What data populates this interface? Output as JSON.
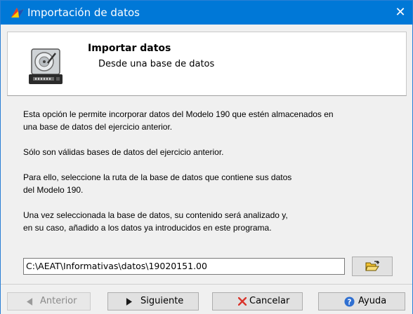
{
  "window": {
    "title": "Importación de datos",
    "close_glyph": "✕"
  },
  "header": {
    "title": "Importar datos",
    "subtitle": "Desde una base de datos",
    "icon": "hard-disk-icon"
  },
  "description": [
    "Esta opción le permite incorporar datos del Modelo 190 que estén almacenados en",
    "una base de datos del ejercicio anterior.",
    "Sólo son válidas bases de datos del ejercicio anterior.",
    "Para ello, seleccione la ruta de la base de datos que contiene sus datos",
    "del Modelo 190.",
    "Una vez seleccionada la base de datos, su contenido será analizado y,",
    "en su caso, añadido a los datos ya introducidos en este programa."
  ],
  "path_field": {
    "value": "C:\\AEAT\\Informativas\\datos\\19020151.00"
  },
  "buttons": {
    "previous": "Anterior",
    "next": "Siguiente",
    "cancel": "Cancelar",
    "help": "Ayuda"
  },
  "colors": {
    "titlebar": "#0078d7",
    "window_bg": "#f0f0f0",
    "cancel_icon": "#d9342b",
    "help_icon": "#2f6fd1"
  }
}
